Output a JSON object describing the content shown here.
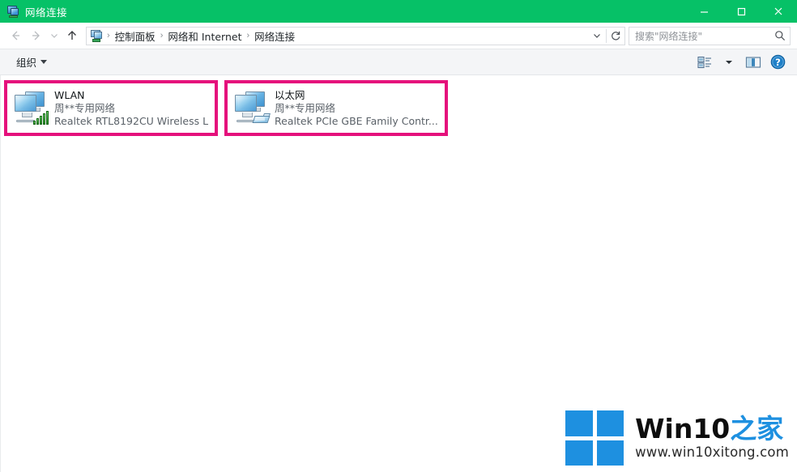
{
  "window": {
    "title": "网络连接",
    "title_icon": "network-connections-icon",
    "minimize_label": "最小化",
    "maximize_label": "最大化",
    "close_label": "关闭",
    "titlebar_color": "#06C167"
  },
  "nav": {
    "back_icon": "arrow-left-icon",
    "forward_icon": "arrow-right-icon",
    "recent_icon": "chevron-down-icon",
    "up_icon": "arrow-up-icon",
    "breadcrumb_icon": "network-connections-icon",
    "breadcrumb": [
      {
        "label": "控制面板"
      },
      {
        "label": "网络和 Internet"
      },
      {
        "label": "网络连接"
      }
    ],
    "separator": "›",
    "dropdown_icon": "chevron-down-icon",
    "refresh_icon": "refresh-icon"
  },
  "search": {
    "placeholder": "搜索\"网络连接\"",
    "value": "",
    "icon": "search-icon"
  },
  "toolbar": {
    "organize_label": "组织",
    "organize_caret": "chevron-down-icon",
    "view_options_icon": "view-options-icon",
    "view_options_caret": "chevron-down-icon",
    "preview_pane_icon": "preview-pane-icon",
    "help_icon": "help-icon",
    "help_color": "#1976c5"
  },
  "highlight": {
    "color": "#E5117C",
    "border_width": "4px"
  },
  "adapters": [
    {
      "name": "WLAN",
      "network": "周**专用网络",
      "device": "Realtek RTL8192CU Wireless L",
      "icon": "wireless-adapter-icon",
      "highlighted": true
    },
    {
      "name": "以太网",
      "network": "周**专用网络",
      "device": "Realtek PCIe GBE Family Contr...",
      "icon": "ethernet-adapter-icon",
      "highlighted": true
    }
  ],
  "watermark": {
    "logo_icon": "windows-logo-icon",
    "brand_latin": "Win10",
    "brand_cn": "之家",
    "url": "www.win10xitong.com",
    "brand_color": "#1E90E0"
  }
}
